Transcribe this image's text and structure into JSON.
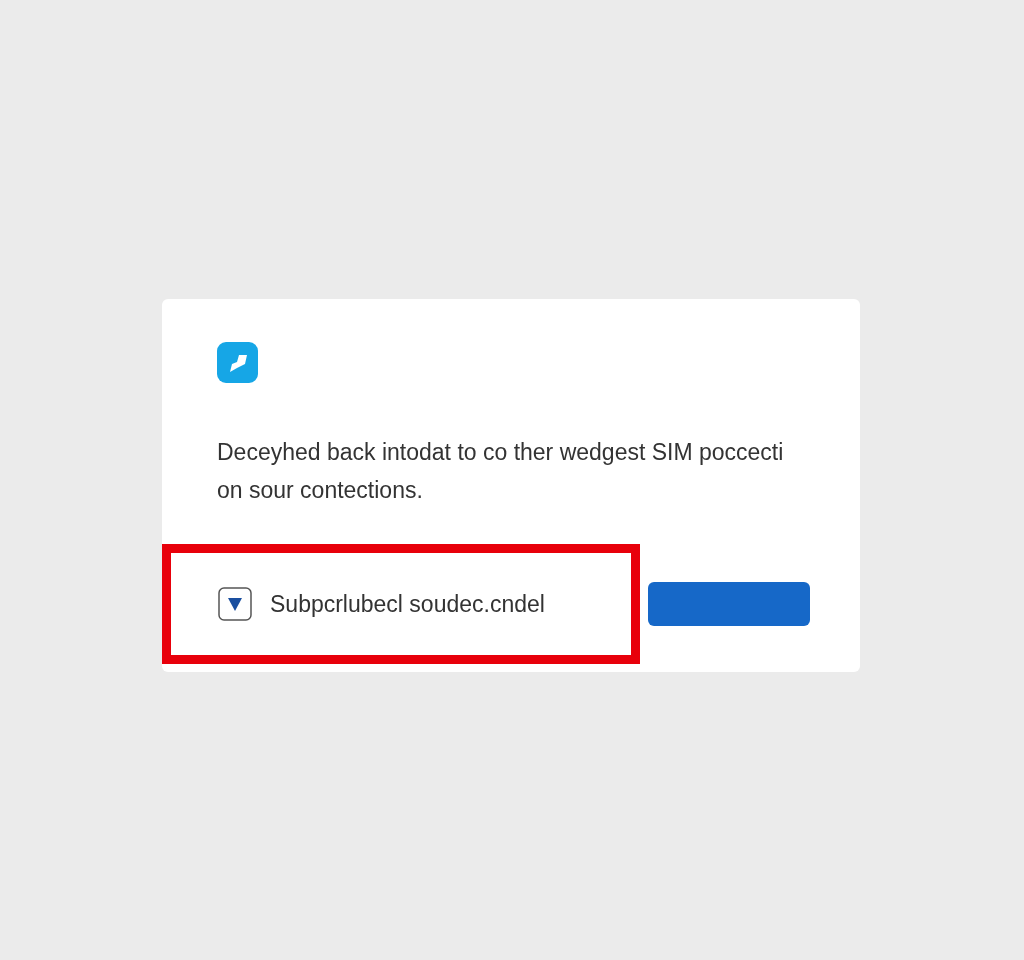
{
  "card": {
    "message": "Deceyhed back intodat to co ther wedgest SIM poccecti on sour contections.",
    "option": {
      "label": "Subpcrlubecl soudec.cndel",
      "highlighted": true
    },
    "button": {
      "kind": "primary"
    }
  }
}
